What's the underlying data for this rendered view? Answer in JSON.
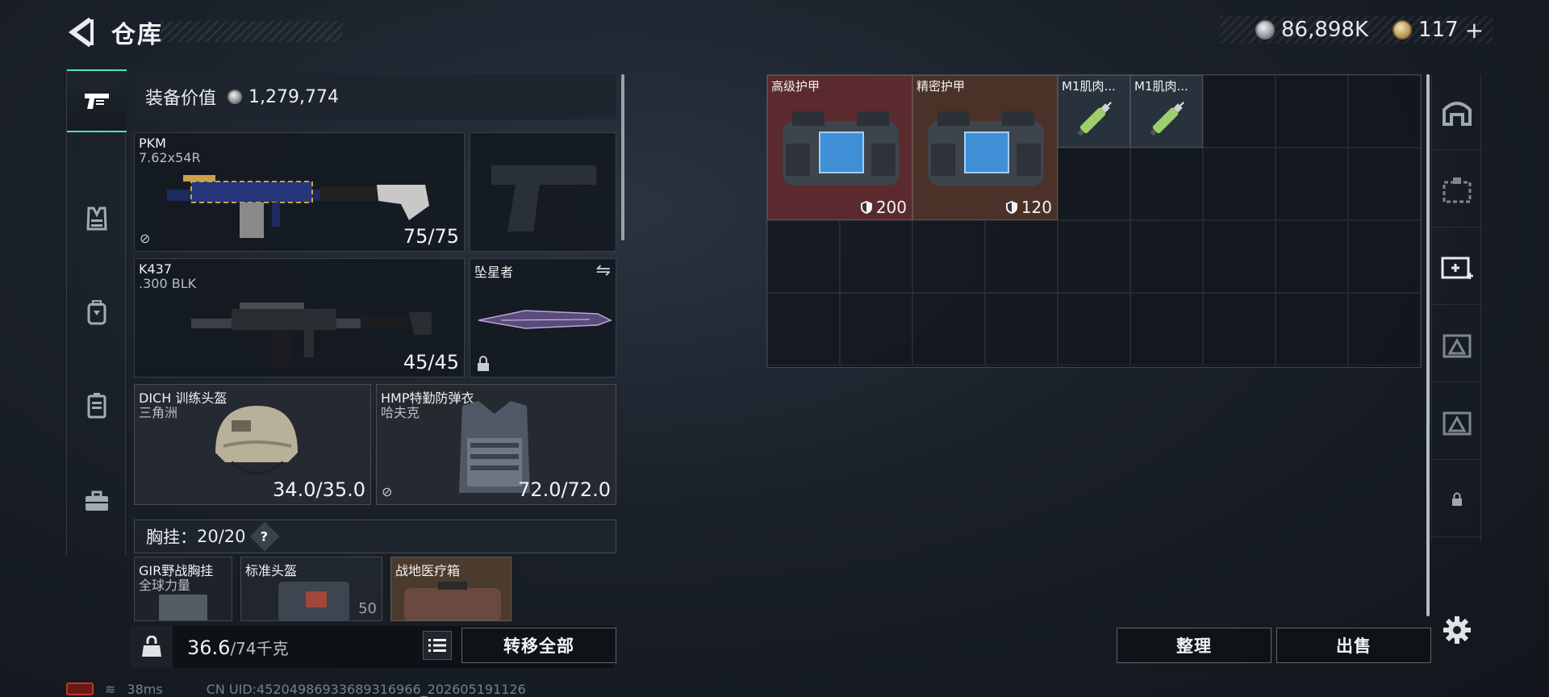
{
  "header": {
    "title": "仓库",
    "silver_amount": "86,898K",
    "gold_amount": "117",
    "gold_plus": "+"
  },
  "nav_left": {
    "items": [
      "weapons-icon",
      "vest-icon",
      "backpack-icon",
      "rig-icon",
      "toolbox-icon"
    ],
    "active": 0
  },
  "loadout": {
    "value_label": "装备价值",
    "value_amount": "1,279,774",
    "primary": {
      "name": "PKM",
      "sub": "7.62x54R",
      "ammo": "75/75"
    },
    "secondary": {
      "name": "K437",
      "sub": ".300 BLK",
      "ammo": "45/45"
    },
    "melee": {
      "name": "坠星者"
    },
    "helmet": {
      "name": "DICH 训练头盔",
      "sub": "三角洲",
      "durability": "34.0/35.0"
    },
    "armor": {
      "name": "HMP特勤防弹衣",
      "sub": "哈夫克",
      "durability": "72.0/72.0"
    },
    "chest_rig_label": "胸挂：",
    "chest_rig_value": "20/20",
    "chest_rig_help": "?",
    "chest_items": [
      {
        "name": "GIR野战胸挂",
        "sub": "全球力量"
      },
      {
        "name": "标准头盔",
        "value": "50"
      },
      {
        "name": "战地医疗箱"
      }
    ]
  },
  "weight": {
    "current": "36.6",
    "max": "/74千克"
  },
  "buttons": {
    "transfer_all": "转移全部",
    "organize": "整理",
    "sell": "出售"
  },
  "status": {
    "ping": "38ms",
    "uid": "CN UID:4520498693368931696​6_202605191126"
  },
  "storage": {
    "items": [
      {
        "name": "高级护甲",
        "value": "200",
        "color": "#5a2a2e"
      },
      {
        "name": "精密护甲",
        "value": "120",
        "color": "#4a3228"
      },
      {
        "name": "M1肌肉...",
        "color": "#27323d"
      },
      {
        "name": "M1肌肉...",
        "color": "#27323d"
      }
    ]
  },
  "nav_right": {
    "items": [
      "warehouse-icon",
      "storage-box-icon",
      "add-storage-icon",
      "expand-storage-icon-1",
      "expand-storage-icon-2",
      "locked-icon"
    ]
  }
}
